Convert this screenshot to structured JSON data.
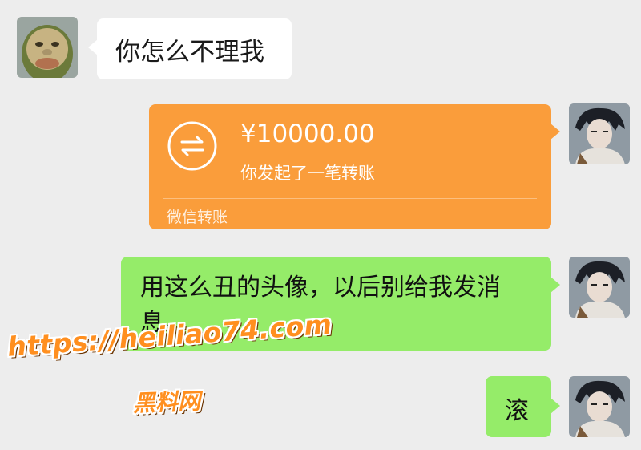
{
  "chat": {
    "incoming": {
      "text": "你怎么不理我"
    },
    "transfer": {
      "amount": "¥10000.00",
      "description": "你发起了一笔转账",
      "footer": "微信转账",
      "color": "#fa9d3b",
      "icon": "transfer-arrows-icon"
    },
    "outgoing": [
      {
        "text": "用这么丑的头像，以后别给我发消息。"
      },
      {
        "text": "滚"
      }
    ]
  },
  "watermark": {
    "url": "https://heiliao74.com",
    "name": "黑料网"
  },
  "colors": {
    "background": "#ededed",
    "bubble_green": "#95ec69",
    "bubble_white": "#ffffff"
  }
}
